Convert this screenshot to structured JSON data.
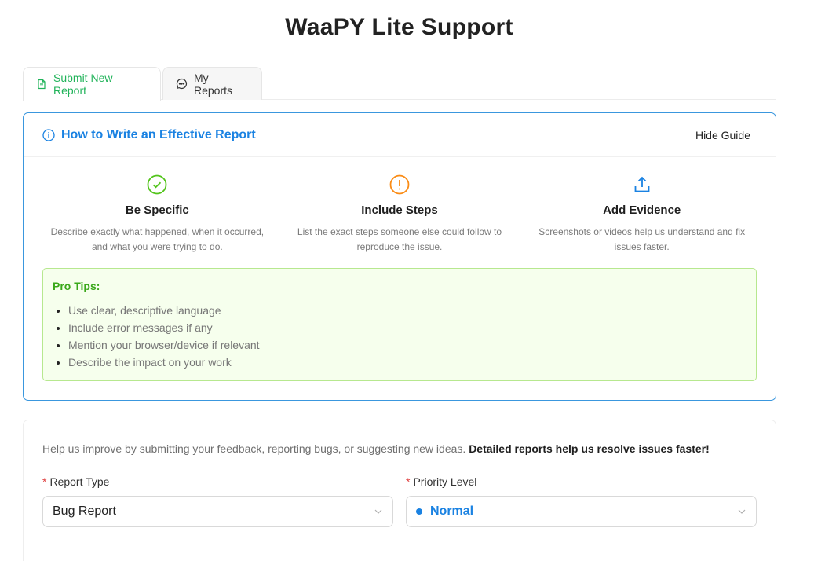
{
  "page": {
    "title": "WaaPY Lite Support"
  },
  "tabs": [
    {
      "label": "Submit New Report",
      "icon": "file-icon",
      "active": true
    },
    {
      "label": "My Reports",
      "icon": "chat-icon",
      "active": false
    }
  ],
  "guide": {
    "title": "How to Write an Effective Report",
    "hide_label": "Hide Guide",
    "items": [
      {
        "icon": "check-circle-icon",
        "color": "#52c41a",
        "title": "Be Specific",
        "text": "Describe exactly what happened, when it occurred, and what you were trying to do."
      },
      {
        "icon": "exclamation-circle-icon",
        "color": "#fa8c16",
        "title": "Include Steps",
        "text": "List the exact steps someone else could follow to reproduce the issue."
      },
      {
        "icon": "upload-icon",
        "color": "#1a82e2",
        "title": "Add Evidence",
        "text": "Screenshots or videos help us understand and fix issues faster."
      }
    ],
    "tips": {
      "title": "Pro Tips:",
      "items": [
        "Use clear, descriptive language",
        "Include error messages if any",
        "Mention your browser/device if relevant",
        "Describe the impact on your work"
      ]
    }
  },
  "form": {
    "intro": "Help us improve by submitting your feedback, reporting bugs, or suggesting new ideas.",
    "intro_bold": "Detailed reports help us resolve issues faster!",
    "report_type": {
      "required_mark": "*",
      "label": "Report Type",
      "value": "Bug Report"
    },
    "priority": {
      "required_mark": "*",
      "label": "Priority Level",
      "value": "Normal",
      "color": "#1a82e2"
    }
  }
}
